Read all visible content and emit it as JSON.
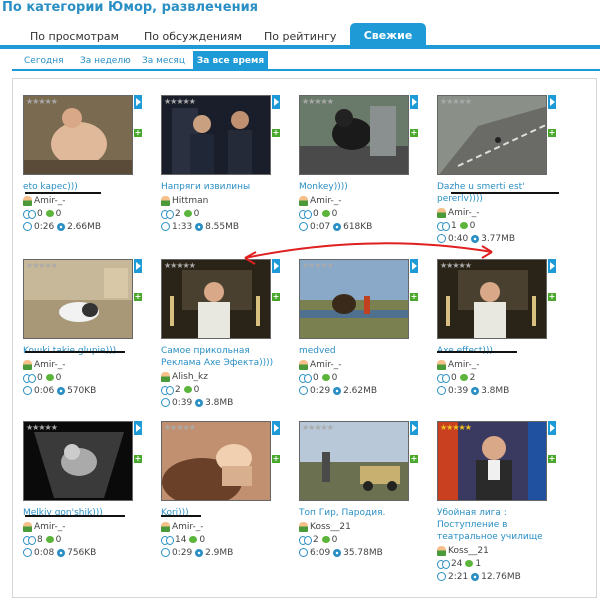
{
  "page_title": "По категории Юмор, развлечения",
  "tabs": [
    {
      "label": "По просмотрам",
      "active": false
    },
    {
      "label": "По обсуждениям",
      "active": false
    },
    {
      "label": "По рейтингу",
      "active": false
    },
    {
      "label": "Свежие",
      "active": true
    }
  ],
  "subtabs": [
    {
      "label": "Сегодня",
      "active": false
    },
    {
      "label": "За неделю",
      "active": false
    },
    {
      "label": "За месяц",
      "active": false
    },
    {
      "label": "За все время",
      "active": true
    }
  ],
  "colors": {
    "accent": "#1e9ad6",
    "link": "#2a8fc4",
    "annotation_red": "#e02020",
    "annotation_black": "#111111"
  },
  "videos": [
    {
      "title": "eto kapec)))",
      "user": "Amir-_-",
      "views": "0",
      "comments": "0",
      "duration": "0:26",
      "size": "2.66MB",
      "stars": "★★★★★",
      "rating_gold": false
    },
    {
      "title": "Напряги извилины",
      "user": "Hittman",
      "views": "2",
      "comments": "0",
      "duration": "1:33",
      "size": "8.55MB",
      "stars": "★★★★★",
      "rating_gold": false
    },
    {
      "title": "Monkey))))",
      "user": "Amir-_-",
      "views": "0",
      "comments": "0",
      "duration": "0:07",
      "size": "618KB",
      "stars": "★★★★★",
      "rating_gold": false
    },
    {
      "title": "Dazhe u smerti est' pererlv))))",
      "user": "Amir-_-",
      "views": "1",
      "comments": "0",
      "duration": "0:40",
      "size": "3.77MB",
      "stars": "★★★★★",
      "rating_gold": false
    },
    {
      "title": "Koшki takie glupie)))",
      "user": "Amir-_-",
      "views": "0",
      "comments": "0",
      "duration": "0:06",
      "size": "570KB",
      "stars": "★★★★★",
      "rating_gold": false
    },
    {
      "title": "Самое прикольная Реклама Axe Эфекта))))",
      "user": "Alish_kz",
      "views": "2",
      "comments": "0",
      "duration": "0:39",
      "size": "3.8MB",
      "stars": "★★★★★",
      "rating_gold": false
    },
    {
      "title": "medved",
      "user": "Amir-_-",
      "views": "0",
      "comments": "0",
      "duration": "0:29",
      "size": "2.62MB",
      "stars": "★★★★★",
      "rating_gold": false
    },
    {
      "title": "Axe effect)))",
      "user": "Amir-_-",
      "views": "0",
      "comments": "2",
      "duration": "0:39",
      "size": "3.8MB",
      "stars": "★★★★★",
      "rating_gold": false
    },
    {
      "title": "Melkiy gon'shik)))",
      "user": "Amir-_-",
      "views": "8",
      "comments": "0",
      "duration": "0:08",
      "size": "756KB",
      "stars": "★★★★★",
      "rating_gold": false
    },
    {
      "title": "Kori)))",
      "user": "Amir-_-",
      "views": "14",
      "comments": "0",
      "duration": "0:29",
      "size": "2.9MB",
      "stars": "★★★★★",
      "rating_gold": false
    },
    {
      "title": "Топ Гир, Пародия.",
      "user": "Koss__21",
      "views": "2",
      "comments": "0",
      "duration": "6:09",
      "size": "35.78MB",
      "stars": "★★★★★",
      "rating_gold": false
    },
    {
      "title": "Убойная лига : Поступление в театральное училище",
      "user": "Koss__21",
      "views": "24",
      "comments": "1",
      "duration": "2:21",
      "size": "12.76MB",
      "stars": "★★★★★",
      "rating_gold": true
    }
  ]
}
